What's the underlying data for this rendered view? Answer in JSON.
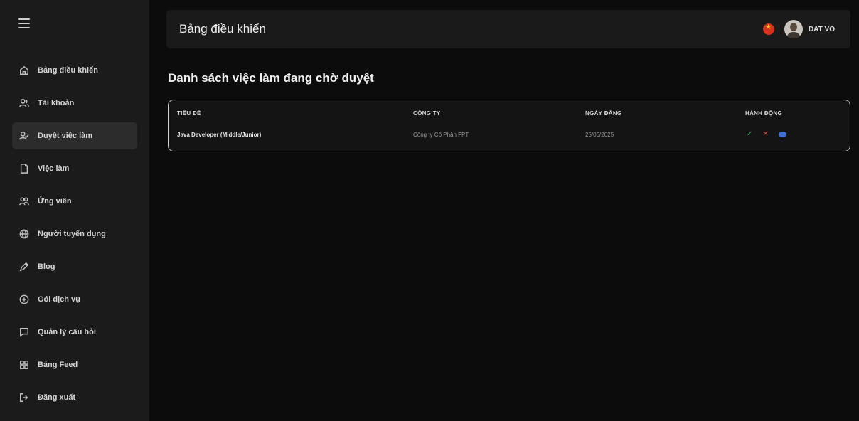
{
  "header": {
    "title": "Bảng điều khiển",
    "username": "DAT VO"
  },
  "sidebar": {
    "items": [
      {
        "label": "Bảng điều khiển",
        "icon": "home-icon"
      },
      {
        "label": "Tài khoản",
        "icon": "users-icon"
      },
      {
        "label": "Duyệt việc làm",
        "icon": "user-check-icon",
        "active": true
      },
      {
        "label": "Việc làm",
        "icon": "file-icon"
      },
      {
        "label": "Ứng viên",
        "icon": "user-group-icon"
      },
      {
        "label": "Người tuyển dụng",
        "icon": "globe-icon"
      },
      {
        "label": "Blog",
        "icon": "pen-icon"
      },
      {
        "label": "Gói dịch vụ",
        "icon": "package-icon"
      },
      {
        "label": "Quản lý câu hỏi",
        "icon": "message-icon"
      },
      {
        "label": "Bảng Feed",
        "icon": "grid-icon"
      },
      {
        "label": "Đăng xuất",
        "icon": "logout-icon"
      }
    ]
  },
  "page": {
    "title": "Danh sách việc làm đang chờ duyệt"
  },
  "table": {
    "columns": [
      "TIÊU ĐỀ",
      "CÔNG TY",
      "NGÀY ĐĂNG",
      "HÀNH ĐỘNG"
    ],
    "rows": [
      {
        "title": "Java Developer (Middle/Junior)",
        "company": "Công ty Cổ Phần FPT",
        "date": "25/06/2025"
      }
    ]
  },
  "colors": {
    "approve": "#3bb26a",
    "reject": "#d24646",
    "view": "#3d6fd6"
  }
}
